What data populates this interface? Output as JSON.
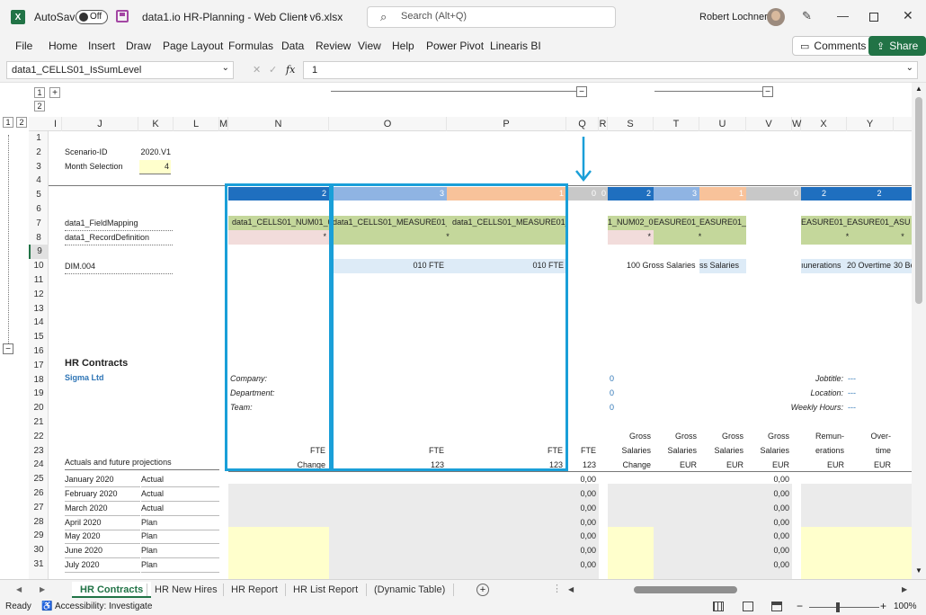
{
  "window": {
    "autosave_label": "AutoSave",
    "autosave_state": "Off",
    "file_title": "data1.io HR-Planning - Web Client v6.xlsx",
    "search_placeholder": "Search (Alt+Q)",
    "user_name": "Robert Lochner"
  },
  "menu": [
    "File",
    "Home",
    "Insert",
    "Draw",
    "Page Layout",
    "Formulas",
    "Data",
    "Review",
    "View",
    "Help",
    "Power Pivot",
    "Linearis BI"
  ],
  "ribbon_buttons": {
    "comments": "Comments",
    "share": "Share"
  },
  "formula_bar": {
    "name_box": "data1_CELLS01_IsSumLevel",
    "fx": "fx",
    "value": "1"
  },
  "outline": {
    "row_levels": [
      "1",
      "2"
    ],
    "col_levels": [
      "1",
      "2"
    ],
    "plus": "+",
    "minus": "−"
  },
  "columns": [
    "I",
    "J",
    "K",
    "L",
    "M",
    "N",
    "O",
    "P",
    "Q",
    "R",
    "S",
    "T",
    "U",
    "V",
    "W",
    "X",
    "Y"
  ],
  "rows": [
    "1",
    "2",
    "3",
    "4",
    "5",
    "6",
    "7",
    "8",
    "9",
    "10",
    "11",
    "12",
    "13",
    "14",
    "15",
    "16",
    "17",
    "18",
    "19",
    "20",
    "21",
    "22",
    "23",
    "24",
    "25",
    "26",
    "27",
    "28",
    "29",
    "30",
    "31"
  ],
  "cells": {
    "scenario_label": "Scenario-ID",
    "scenario_value": "2020.V1",
    "month_label": "Month Selection",
    "month_value": "4",
    "r5_n": "2",
    "r5_o": "3",
    "r5_p": "1",
    "r5_q": "0",
    "r5_r": "0",
    "r5_s": "2",
    "r5_t": "3",
    "r5_u": "1",
    "r5_v": "0",
    "r5_x": "2",
    "r5_y": "2",
    "field_mapping": "data1_FieldMapping",
    "record_def": "data1_RecordDefinition",
    "r7_n": "data1_CELLS01_NUM01_0",
    "r7_o": "data1_CELLS01_MEASURE01_0",
    "r7_p": "data1_CELLS01_MEASURE01_0",
    "r7_s": "1_NUM02_0",
    "r7_t": "EASURE01_0",
    "r7_u": "EASURE01_0",
    "r7_x": "EASURE01_0",
    "r7_y": "EASURE01_0",
    "r7_z": "ASU",
    "star": "*",
    "dim_label": "DIM.004",
    "r10_o": "010 FTE",
    "r10_p": "010 FTE",
    "r10_s": "100 Gross Salaries",
    "r10_u": "ss Salaries",
    "r10_x": "ıunerations",
    "r10_y": "20 Overtime",
    "r10_z": "30 Be",
    "hr_contracts": "HR Contracts",
    "sigma": "Sigma Ltd",
    "company": "Company:",
    "department": "Department:",
    "team": "Team:",
    "zero": "0",
    "jobtitle": "Jobtitle:",
    "location": "Location:",
    "weekly_hours": "Weekly Hours:",
    "dash": "---",
    "fte": "FTE",
    "change": "Change",
    "v123": "123",
    "gross": "Gross",
    "salaries": "Salaries",
    "eur": "EUR",
    "remun": "Remun-",
    "erations": "erations",
    "over": "Over-",
    "time": "time",
    "actuals_label": "Actuals and future projections",
    "zero_dec": "0,00"
  },
  "months": [
    {
      "month": "January 2020",
      "type": "Actual"
    },
    {
      "month": "February 2020",
      "type": "Actual"
    },
    {
      "month": "March 2020",
      "type": "Actual"
    },
    {
      "month": "April 2020",
      "type": "Plan"
    },
    {
      "month": "May 2020",
      "type": "Plan"
    },
    {
      "month": "June 2020",
      "type": "Plan"
    },
    {
      "month": "July 2020",
      "type": "Plan"
    }
  ],
  "sheet_tabs": [
    "HR Contracts",
    "HR New Hires",
    "HR Report",
    "HR List Report",
    "(Dynamic Table)"
  ],
  "status": {
    "ready": "Ready",
    "accessibility": "Accessibility: Investigate",
    "zoom": "100%"
  },
  "colors": {
    "excel_green": "#217346",
    "blue_dark": "#1f6fbf",
    "blue_light": "#8fb4e3",
    "orange": "#f8c29a",
    "gray": "#c8c8c8",
    "green_cell": "#c4d79b",
    "pink_cell": "#f2dcdb",
    "yellow_cell": "#ffffcc",
    "highlight": "#1a9fd8"
  }
}
